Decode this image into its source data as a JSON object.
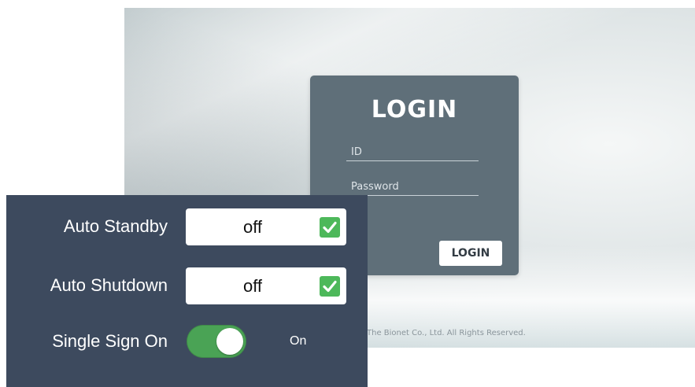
{
  "login_screen": {
    "title": "LOGIN",
    "id_placeholder": "ID",
    "password_placeholder": "Password",
    "login_button": "LOGIN",
    "copyright": "The Bionet Co., Ltd. All Rights Reserved."
  },
  "settings": {
    "auto_standby": {
      "label": "Auto Standby",
      "value": "off",
      "checked": true
    },
    "auto_shutdown": {
      "label": "Auto Shutdown",
      "value": "off",
      "checked": true
    },
    "single_sign_on": {
      "label": "Single Sign On",
      "state": "On",
      "enabled": true
    }
  },
  "colors": {
    "panel_bg": "#3d4a5e",
    "login_card_bg": "#5f6f79",
    "check_green": "#4db85a",
    "toggle_green": "#4aa355"
  },
  "icons": {
    "check": "checkbox-checked-icon"
  }
}
